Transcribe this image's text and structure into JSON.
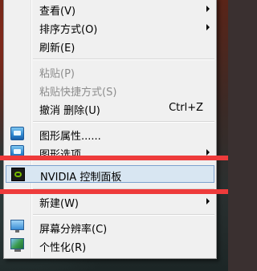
{
  "menu": {
    "items": [
      {
        "label": "查看(V)",
        "submenu": true
      },
      {
        "label": "排序方式(O)",
        "submenu": true
      },
      {
        "label": "刷新(E)"
      },
      {
        "label": "粘贴(P)",
        "disabled": true
      },
      {
        "label": "粘贴快捷方式(S)",
        "disabled": true
      },
      {
        "label": "撤消 删除(U)",
        "shortcut": "Ctrl+Z"
      },
      {
        "label": "图形属性......",
        "icon": "graphics-properties-icon"
      },
      {
        "label": "图形选项",
        "icon": "graphics-options-icon",
        "submenu": true
      },
      {
        "label": "NVIDIA 控制面板",
        "icon": "nvidia-icon",
        "highlighted": true
      },
      {
        "label": "新建(W)",
        "submenu": true
      },
      {
        "label": "屏幕分辨率(C)",
        "icon": "monitor-icon"
      },
      {
        "label": "个性化(R)",
        "icon": "personalize-icon"
      }
    ]
  },
  "colors": {
    "menu_bg": "#f0f0f0",
    "highlight_bg": "#d8e6f2",
    "highlight_border": "#7da2ce",
    "annotation_red": "#ee3b3b",
    "nvidia_green": "#76b900"
  }
}
